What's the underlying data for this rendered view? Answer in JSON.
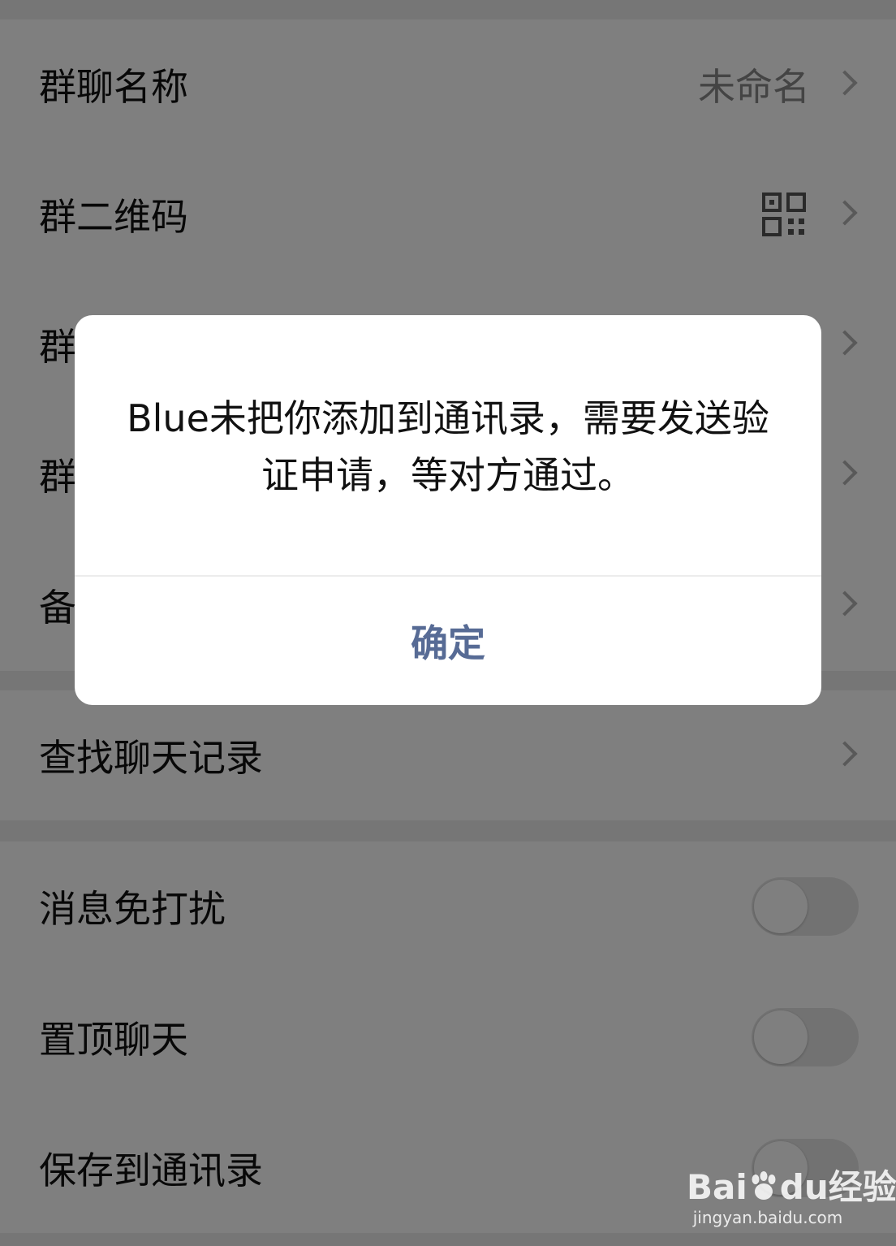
{
  "settings": {
    "group_name": {
      "label": "群聊名称",
      "value": "未命名"
    },
    "group_qr": {
      "label": "群二维码"
    },
    "group_notice": {
      "label": "群"
    },
    "group_manage": {
      "label": "群"
    },
    "remark": {
      "label": "备"
    },
    "search_history": {
      "label": "查找聊天记录"
    },
    "mute": {
      "label": "消息免打扰",
      "enabled": false
    },
    "pin": {
      "label": "置顶聊天",
      "enabled": false
    },
    "save_contacts": {
      "label": "保存到通讯录",
      "enabled": false
    }
  },
  "dialog": {
    "message": "Blue未把你添加到通讯录，需要发送验证申请，等对方通过。",
    "confirm_label": "确定",
    "confirm_color": "#576b95"
  },
  "watermark": {
    "logo_text": "Bai",
    "logo_text_2": "du",
    "logo_text_3": "经验",
    "url": "jingyan.baidu.com"
  }
}
